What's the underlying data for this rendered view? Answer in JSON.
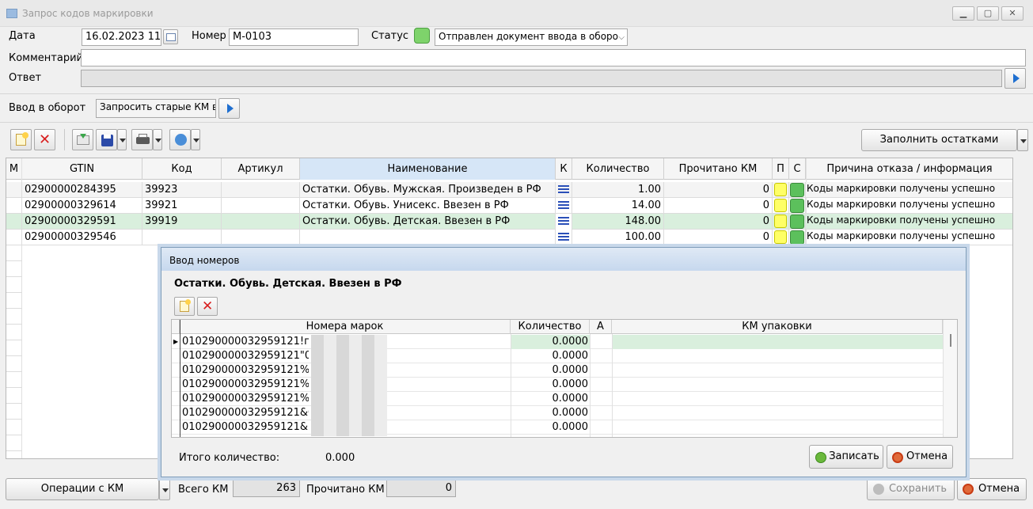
{
  "window": {
    "title": "Запрос кодов маркировки",
    "minimize": "▁",
    "maximize": "▢",
    "close": "✕"
  },
  "form": {
    "date_label": "Дата",
    "date_value": "16.02.2023 11",
    "number_label": "Номер",
    "number_value": "М-0103",
    "status_label": "Статус",
    "status_value": "Отправлен документ ввода в оборо",
    "comment_label": "Комментарий",
    "comment_value": "",
    "answer_label": "Ответ",
    "answer_value": "",
    "turnover_label": "Ввод в оборот",
    "turnover_value": "Запросить старые КМ в"
  },
  "toolbar": {
    "fill_button": "Заполнить остатками"
  },
  "grid": {
    "columns": [
      "М",
      "GTIN",
      "Код",
      "Артикул",
      "Наименование",
      "К",
      "Количество",
      "Прочитано КМ",
      "П",
      "С",
      "Причина отказа / информация"
    ],
    "rows": [
      {
        "gtin": "02900000284395",
        "code": "39923",
        "article": "",
        "name": "Остатки. Обувь. Мужская. Произведен в РФ",
        "qty": "1.00",
        "read": "0",
        "info": "Коды маркировки получены успешно"
      },
      {
        "gtin": "02900000329614",
        "code": "39921",
        "article": "",
        "name": "Остатки. Обувь. Унисекс. Ввезен в РФ",
        "qty": "14.00",
        "read": "0",
        "info": "Коды маркировки получены успешно"
      },
      {
        "gtin": "02900000329591",
        "code": "39919",
        "article": "",
        "name": "Остатки. Обувь. Детская. Ввезен в РФ",
        "qty": "148.00",
        "read": "0",
        "info": "Коды маркировки получены успешно"
      },
      {
        "gtin": "02900000329546",
        "code": "",
        "article": "",
        "name": "",
        "qty": "100.00",
        "read": "0",
        "info": "Коды маркировки получены успешно"
      }
    ]
  },
  "bottom": {
    "operations_button": "Операции с  КМ",
    "total_label": "Всего КМ",
    "total_value": "263",
    "read_label": "Прочитано КМ",
    "read_value": "0",
    "save_button": "Сохранить",
    "cancel_button": "Отмена"
  },
  "dialog": {
    "title": "Ввод номеров",
    "product": "Остатки. Обувь. Детская. Ввезен в РФ",
    "columns": [
      "Номера марок",
      "Количество",
      "А",
      "КМ упаковки"
    ],
    "rows": [
      {
        "mark": "010290000032959121!пр",
        "qty": "0.0000"
      },
      {
        "mark": "010290000032959121\"0b",
        "qty": "0.0000"
      },
      {
        "mark": "010290000032959121%L",
        "qty": "0.0000"
      },
      {
        "mark": "010290000032959121%ll",
        "qty": "0.0000"
      },
      {
        "mark": "010290000032959121%T",
        "qty": "0.0000"
      },
      {
        "mark": "010290000032959121&O",
        "qty": "0.0000"
      },
      {
        "mark": "010290000032959121&p",
        "qty": "0.0000"
      }
    ],
    "total_label": "Итого количество:",
    "total_value": "0.000",
    "save_button": "Записать",
    "cancel_button": "Отмена"
  },
  "colors": {
    "status_green": "#7ed36b",
    "selected_row": "#d9efdd",
    "header_selected": "#d6e6f7",
    "accent_blue": "#1f6fd0"
  }
}
